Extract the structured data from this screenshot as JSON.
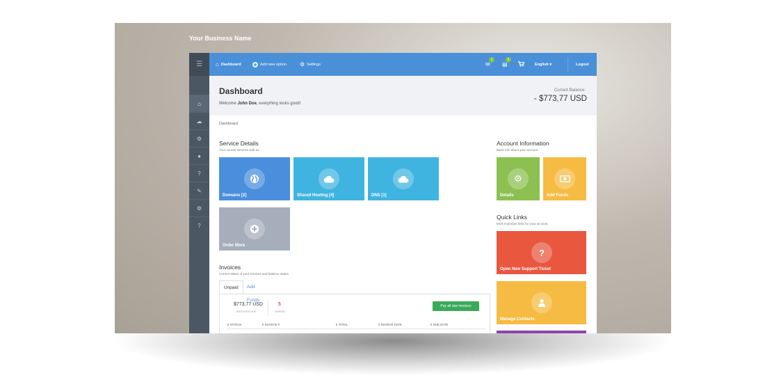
{
  "business_name": "Your Business Name",
  "topnav": {
    "dashboard": "Dashboard",
    "add_option": "Add new option",
    "settings": "Settings",
    "mail_badge": "1",
    "docs_badge": "5",
    "language": "English ▾",
    "logout": "Logout"
  },
  "header": {
    "title": "Dashboard",
    "welcome_pre": "Welcome ",
    "user": "John Doe",
    "welcome_post": ", everything looks good!",
    "balance_label": "Current Balance:",
    "balance": "- $773,77 USD"
  },
  "breadcrumb": "Dashboard",
  "service_details": {
    "title": "Service Details",
    "subtitle": "Your current services with us.",
    "tiles": [
      {
        "label": "Domains [2]",
        "color": "#4a8fdc",
        "icon": "globe-icon"
      },
      {
        "label": "Shared Hosting [4]",
        "color": "#40b4e0",
        "icon": "cloud-icon"
      },
      {
        "label": "DNS [1]",
        "color": "#40b4e0",
        "icon": "cloud-icon"
      },
      {
        "label": "Order More",
        "color": "#a7aebb",
        "icon": "plus-icon"
      }
    ]
  },
  "account_info": {
    "title": "Account Information",
    "subtitle": "Basic info about your account.",
    "tiles": [
      {
        "label": "Details",
        "color": "#8cc152",
        "icon": "gear-icon"
      },
      {
        "label": "Add Funds",
        "color": "#f6bb42",
        "icon": "money-icon"
      }
    ]
  },
  "quick_links": {
    "title": "Quick Links",
    "subtitle": "Most important links for your account.",
    "tiles": [
      {
        "label": "Open New Support Ticket",
        "color": "#e9573f",
        "icon": "question-icon"
      },
      {
        "label": "Manage Contacts",
        "color": "#f6bb42",
        "icon": "user-icon"
      }
    ]
  },
  "invoices": {
    "title": "Invoices",
    "subtitle": "Current status of your invoices and balance status.",
    "tabs": [
      "Unpaid",
      "Add Funds"
    ],
    "amount": "$773,77 USD",
    "amount_label": "INVOICES DUE",
    "unpaid_count": "5",
    "unpaid_label": "UNPAID",
    "pay_button": "Pay all due invoices",
    "columns": [
      "STATUS",
      "INVOICE #",
      "TOTAL",
      "INVOICE DATE",
      "DUE DATE"
    ]
  },
  "sidebar_icons": [
    "home-icon",
    "cloud-icon",
    "gear-icon",
    "user-icon",
    "question-icon",
    "pencil-icon",
    "gear-icon",
    "question-icon"
  ]
}
